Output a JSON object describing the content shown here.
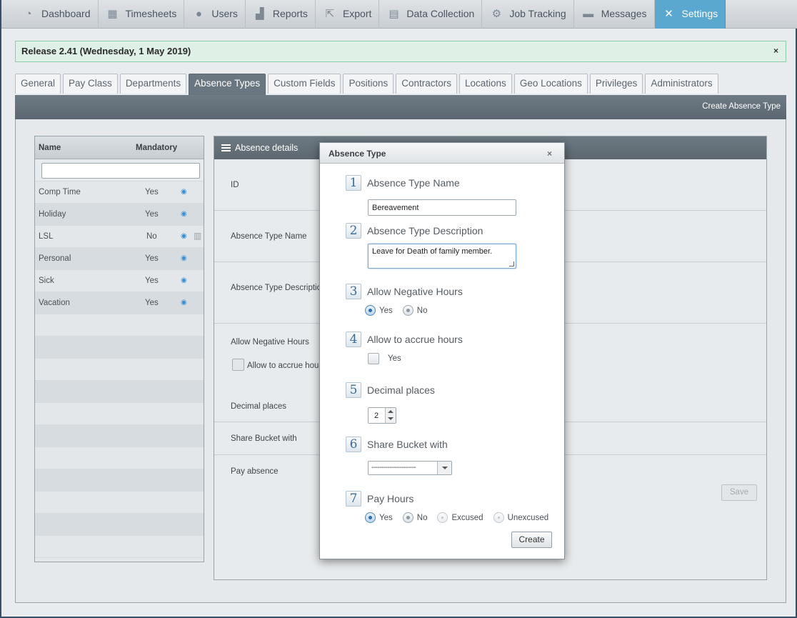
{
  "nav": {
    "items": [
      {
        "label": "Dashboard",
        "icon": "dashboard-icon",
        "glyph": "◔"
      },
      {
        "label": "Timesheets",
        "icon": "calendar-icon",
        "glyph": "▦"
      },
      {
        "label": "Users",
        "icon": "user-icon",
        "glyph": "●"
      },
      {
        "label": "Reports",
        "icon": "bar-chart-icon",
        "glyph": "▟"
      },
      {
        "label": "Export",
        "icon": "export-icon",
        "glyph": "⇱"
      },
      {
        "label": "Data Collection",
        "icon": "data-collection-icon",
        "glyph": "▤"
      },
      {
        "label": "Job Tracking",
        "icon": "job-tracking-icon",
        "glyph": "⚙"
      },
      {
        "label": "Messages",
        "icon": "message-icon",
        "glyph": "▬"
      },
      {
        "label": "Settings",
        "icon": "wrench-icon",
        "glyph": "✕",
        "active": true
      }
    ]
  },
  "banner": {
    "text": "Release 2.41 (Wednesday, 1 May 2019)",
    "close": "×"
  },
  "tabs": [
    {
      "label": "General"
    },
    {
      "label": "Pay Class"
    },
    {
      "label": "Departments"
    },
    {
      "label": "Absence Types",
      "active": true
    },
    {
      "label": "Custom Fields"
    },
    {
      "label": "Positions"
    },
    {
      "label": "Contractors"
    },
    {
      "label": "Locations"
    },
    {
      "label": "Geo Locations"
    },
    {
      "label": "Privileges"
    },
    {
      "label": "Administrators"
    }
  ],
  "toolbar": {
    "create_label": "Create Absence Type"
  },
  "list": {
    "header_name": "Name",
    "header_mandatory": "Mandatory",
    "filter_value": "",
    "rows": [
      {
        "name": "Comp Time",
        "mandatory": "Yes",
        "deletable": false
      },
      {
        "name": "Holiday",
        "mandatory": "Yes",
        "deletable": false
      },
      {
        "name": "LSL",
        "mandatory": "No",
        "deletable": true
      },
      {
        "name": "Personal",
        "mandatory": "Yes",
        "deletable": false
      },
      {
        "name": "Sick",
        "mandatory": "Yes",
        "deletable": false
      },
      {
        "name": "Vacation",
        "mandatory": "Yes",
        "deletable": false
      }
    ],
    "empty_row_count": 11
  },
  "details": {
    "title": "Absence details",
    "id_label": "ID",
    "name_label": "Absence Type Name",
    "description_label": "Absence Type Description",
    "negative_label": "Allow Negative Hours",
    "accrue_label": "Allow to accrue hours",
    "decimal_label": "Decimal places",
    "share_label": "Share Bucket with",
    "pay_label": "Pay absence",
    "save_label": "Save"
  },
  "modal": {
    "title": "Absence Type",
    "close": "×",
    "step1": {
      "num": "1",
      "label": "Absence Type Name",
      "value": "Bereavement"
    },
    "step2": {
      "num": "2",
      "label": "Absence Type Description",
      "value": "Leave for Death of family member."
    },
    "step3": {
      "num": "3",
      "label": "Allow Negative Hours",
      "yes": "Yes",
      "no": "No",
      "selected": "Yes"
    },
    "step4": {
      "num": "4",
      "label": "Allow to accrue hours",
      "yes": "Yes",
      "checked": false
    },
    "step5": {
      "num": "5",
      "label": "Decimal places",
      "value": "2"
    },
    "step6": {
      "num": "6",
      "label": "Share Bucket with",
      "value": "----------------------"
    },
    "step7": {
      "num": "7",
      "label": "Pay Hours",
      "yes": "Yes",
      "no": "No",
      "excused": "Excused",
      "unexcused": "Unexcused",
      "selected": "Yes"
    },
    "create_label": "Create"
  },
  "colors": {
    "accent": "#5aa7cf",
    "header": "#5c676f",
    "banner_bg": "#dff0e6"
  }
}
